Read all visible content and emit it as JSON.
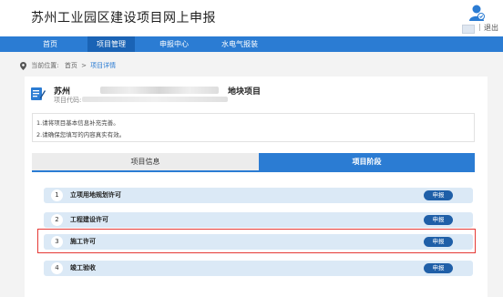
{
  "header": {
    "title": "苏州工业园区建设项目网上申报",
    "separator": "|",
    "logout": "退出"
  },
  "nav": {
    "items": [
      {
        "label": "首页"
      },
      {
        "label": "项目管理",
        "active": true
      },
      {
        "label": "申报中心"
      },
      {
        "label": "水电气报装"
      }
    ]
  },
  "breadcrumb": {
    "prefix": "当前位置:",
    "home": "首页",
    "arrow": ">",
    "current": "项目详情"
  },
  "project": {
    "name_prefix": "苏州",
    "name_suffix": "地块项目",
    "code_label": "项目代码:",
    "code_value": "20"
  },
  "notice": {
    "lines": [
      "1.请将项目基本信息补充完善。",
      "2.请确保您填写的内容真实有效。"
    ]
  },
  "tabs": [
    {
      "label": "项目信息"
    },
    {
      "label": "项目阶段",
      "active": true
    }
  ],
  "stages": [
    {
      "num": "1",
      "label": "立项用地规划许可",
      "button": "申报"
    },
    {
      "num": "2",
      "label": "工程建设许可",
      "button": "申报"
    },
    {
      "num": "3",
      "label": "施工许可",
      "button": "申报",
      "highlighted": true
    },
    {
      "num": "4",
      "label": "竣工验收",
      "button": "申报"
    }
  ],
  "colors": {
    "primary": "#2b7cd3",
    "nav_active": "#1a63b5",
    "stage_bg": "#dbe9f6",
    "button": "#1f5fa8",
    "highlight": "#e53935"
  }
}
